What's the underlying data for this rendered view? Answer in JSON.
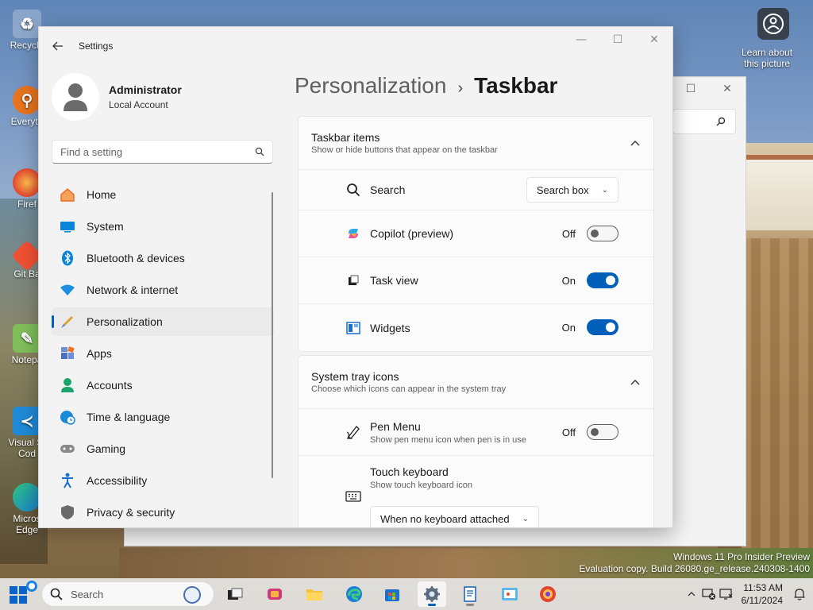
{
  "desktop": {
    "icons": [
      {
        "label": "Recycle",
        "icon": "recycle-bin-icon"
      },
      {
        "label": "Everyth",
        "icon": "everything-search-icon"
      },
      {
        "label": "Firef",
        "icon": "firefox-icon"
      },
      {
        "label": "Git Ba",
        "icon": "git-bash-icon"
      },
      {
        "label": "Notepa",
        "icon": "notepad-icon"
      },
      {
        "label": "Visual St Cod",
        "icon": "vscode-icon"
      },
      {
        "label": "Micros Edge",
        "icon": "edge-icon"
      }
    ],
    "spotlight_label": "Learn about this picture",
    "watermark_line1": "Windows 11 Pro Insider Preview",
    "watermark_line2": "Evaluation copy. Build 26080.ge_release.240308-1400"
  },
  "settings": {
    "app_title": "Settings",
    "user": {
      "name": "Administrator",
      "type": "Local Account"
    },
    "search_placeholder": "Find a setting",
    "nav": [
      {
        "label": "Home",
        "icon": "home-icon",
        "color": "#e8702a"
      },
      {
        "label": "System",
        "icon": "system-icon",
        "color": "#0a84d8"
      },
      {
        "label": "Bluetooth & devices",
        "icon": "bluetooth-icon",
        "color": "#0a84d8"
      },
      {
        "label": "Network & internet",
        "icon": "wifi-icon",
        "color": "#1d8fe0"
      },
      {
        "label": "Personalization",
        "icon": "brush-icon",
        "color": "#e0a030",
        "active": true
      },
      {
        "label": "Apps",
        "icon": "apps-icon",
        "color": "#4a70c8"
      },
      {
        "label": "Accounts",
        "icon": "accounts-icon",
        "color": "#1aa36b"
      },
      {
        "label": "Time & language",
        "icon": "globe-clock-icon",
        "color": "#1a8ad8"
      },
      {
        "label": "Gaming",
        "icon": "gamepad-icon",
        "color": "#7a7a7a"
      },
      {
        "label": "Accessibility",
        "icon": "accessibility-icon",
        "color": "#1a6fd0"
      },
      {
        "label": "Privacy & security",
        "icon": "shield-icon",
        "color": "#6a6a6a"
      }
    ],
    "breadcrumb": {
      "parent": "Personalization",
      "separator": "›",
      "current": "Taskbar"
    },
    "taskbar_items": {
      "title": "Taskbar items",
      "subtitle": "Show or hide buttons that appear on the taskbar",
      "search": {
        "label": "Search",
        "value": "Search box"
      },
      "copilot": {
        "label": "Copilot (preview)",
        "state": "Off"
      },
      "task_view": {
        "label": "Task view",
        "state": "On"
      },
      "widgets": {
        "label": "Widgets",
        "state": "On"
      }
    },
    "system_tray": {
      "title": "System tray icons",
      "subtitle": "Choose which icons can appear in the system tray",
      "pen_menu": {
        "label": "Pen Menu",
        "sub": "Show pen menu icon when pen is in use",
        "state": "Off"
      },
      "touch_keyboard": {
        "label": "Touch keyboard",
        "sub": "Show touch keyboard icon",
        "value": "When no keyboard attached"
      }
    }
  },
  "taskbar": {
    "search_placeholder": "Search",
    "time": "11:53 AM",
    "date": "6/11/2024"
  },
  "colors": {
    "accent": "#005fb8"
  }
}
